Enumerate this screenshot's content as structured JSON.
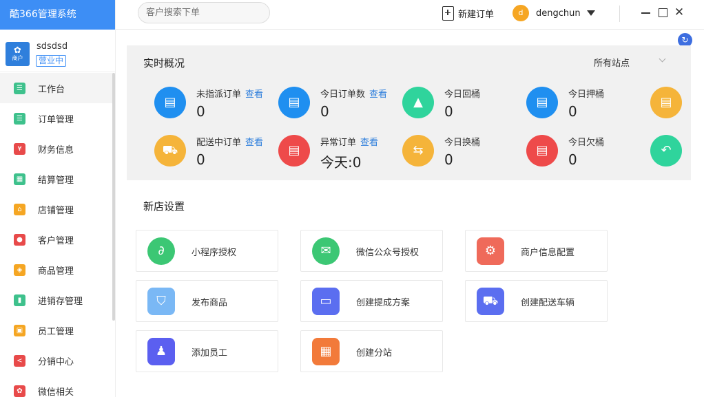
{
  "sidebar": {
    "brand": "酷366管理系统",
    "shop_name": "sdsdsd",
    "shop_status": "营业中",
    "shop_logo_text": "商户",
    "items": [
      {
        "label": "工作台",
        "icon": "dashboard-icon",
        "color": "#3ec18c"
      },
      {
        "label": "订单管理",
        "icon": "order-icon",
        "color": "#3ec18c"
      },
      {
        "label": "财务信息",
        "icon": "finance-icon",
        "color": "#e84a4a"
      },
      {
        "label": "结算管理",
        "icon": "settlement-icon",
        "color": "#3ec18c"
      },
      {
        "label": "店铺管理",
        "icon": "store-icon",
        "color": "#f5a623"
      },
      {
        "label": "客户管理",
        "icon": "customer-icon",
        "color": "#e84a4a"
      },
      {
        "label": "商品管理",
        "icon": "product-icon",
        "color": "#f5a623"
      },
      {
        "label": "进销存管理",
        "icon": "inventory-icon",
        "color": "#3ec18c"
      },
      {
        "label": "员工管理",
        "icon": "staff-icon",
        "color": "#f5a623"
      },
      {
        "label": "分销中心",
        "icon": "distribution-icon",
        "color": "#e84a4a"
      },
      {
        "label": "微信相关",
        "icon": "wechat-icon",
        "color": "#e84a4a"
      }
    ]
  },
  "topbar": {
    "search_placeholder": "客户搜索下单",
    "new_order": "新建订单",
    "avatar_letter": "d",
    "username": "dengchun",
    "close_glyph": "✕"
  },
  "overview": {
    "title": "实时概况",
    "station": "所有站点",
    "link_label": "查看",
    "stats": [
      {
        "label": "未指派订单",
        "value": "0",
        "link": true,
        "color": "#1f8ff0",
        "icon": "unassigned-order-icon"
      },
      {
        "label": "今日订单数",
        "value": "0",
        "link": true,
        "color": "#1f8ff0",
        "icon": "today-orders-icon"
      },
      {
        "label": "今日回桶",
        "value": "0",
        "link": false,
        "color": "#2fd49c",
        "icon": "bucket-return-icon"
      },
      {
        "label": "今日押桶",
        "value": "0",
        "link": false,
        "color": "#1f8ff0",
        "icon": "bucket-deposit-icon"
      },
      {
        "label": "",
        "value": "",
        "link": false,
        "color": "#f5b43a",
        "icon": "report-icon"
      },
      {
        "label": "配送中订单",
        "value": "0",
        "link": true,
        "color": "#f5b43a",
        "icon": "delivery-truck-icon"
      },
      {
        "label": "异常订单",
        "value": "今天:0",
        "link": true,
        "color": "#ee4a4a",
        "icon": "abnormal-order-icon"
      },
      {
        "label": "今日换桶",
        "value": "0",
        "link": false,
        "color": "#f5b43a",
        "icon": "bucket-exchange-icon"
      },
      {
        "label": "今日欠桶",
        "value": "0",
        "link": false,
        "color": "#ee4a4a",
        "icon": "bucket-owed-icon"
      },
      {
        "label": "",
        "value": "",
        "link": false,
        "color": "#2fd49c",
        "icon": "undo-icon"
      }
    ]
  },
  "setup": {
    "title": "新店设置",
    "cards": [
      {
        "label": "小程序授权",
        "color": "#3cc774",
        "icon": "mini-program-icon"
      },
      {
        "label": "微信公众号授权",
        "color": "#3cc774",
        "icon": "wechat-official-icon"
      },
      {
        "label": "商户信息配置",
        "color": "#ef6a5a",
        "icon": "merchant-settings-icon"
      },
      {
        "label": "发布商品",
        "color": "#7ab8f5",
        "icon": "publish-product-icon"
      },
      {
        "label": "创建提成方案",
        "color": "#5b6ef0",
        "icon": "commission-plan-icon"
      },
      {
        "label": "创建配送车辆",
        "color": "#5b6ef0",
        "icon": "delivery-vehicle-icon"
      },
      {
        "label": "添加员工",
        "color": "#5b5ff0",
        "icon": "add-staff-icon"
      },
      {
        "label": "创建分站",
        "color": "#f27a3a",
        "icon": "create-branch-icon"
      }
    ]
  }
}
